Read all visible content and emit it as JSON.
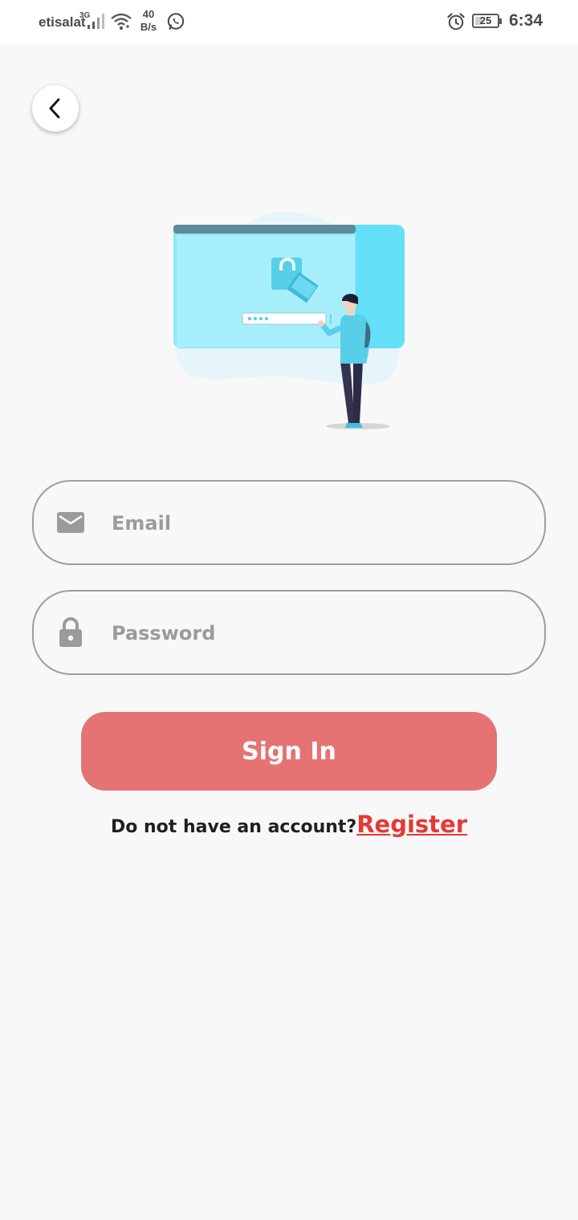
{
  "status_bar": {
    "carrier": "etisalat",
    "network": "3G",
    "speed_value": "40",
    "speed_unit": "B/s",
    "battery": "25",
    "time": "6:34"
  },
  "icons": {
    "back": "chevron-left-icon",
    "email": "envelope-icon",
    "password": "lock-icon"
  },
  "form": {
    "email_placeholder": "Email",
    "email_value": "",
    "password_placeholder": "Password",
    "password_value": ""
  },
  "actions": {
    "sign_in_label": "Sign In",
    "register_prompt": "Do not have an account?",
    "register_label": "Register"
  },
  "colors": {
    "primary_button": "#e57373",
    "link": "#e53935",
    "illustration_accent": "#64dff8"
  }
}
